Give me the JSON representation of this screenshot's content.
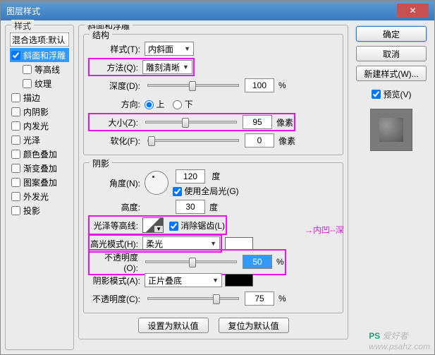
{
  "window": {
    "title": "图层样式"
  },
  "sidebar": {
    "group_label": "样式",
    "items": [
      {
        "label": "混合选项:默认",
        "checked": false,
        "header": true
      },
      {
        "label": "斜面和浮雕",
        "checked": true,
        "selected": true
      },
      {
        "label": "等高线",
        "checked": false,
        "indent": true
      },
      {
        "label": "纹理",
        "checked": false,
        "indent": true
      },
      {
        "label": "描边",
        "checked": false
      },
      {
        "label": "内阴影",
        "checked": false
      },
      {
        "label": "内发光",
        "checked": false
      },
      {
        "label": "光泽",
        "checked": false
      },
      {
        "label": "颜色叠加",
        "checked": false
      },
      {
        "label": "渐变叠加",
        "checked": false
      },
      {
        "label": "图案叠加",
        "checked": false
      },
      {
        "label": "外发光",
        "checked": false
      },
      {
        "label": "投影",
        "checked": false
      }
    ]
  },
  "main": {
    "panel_title": "斜面和浮雕",
    "structure": {
      "group_label": "结构",
      "style_label": "样式(T):",
      "style_value": "内斜面",
      "technique_label": "方法(Q):",
      "technique_value": "雕刻清晰",
      "depth_label": "深度(D):",
      "depth_value": "100",
      "depth_unit": "%",
      "direction_label": "方向:",
      "dir_up": "上",
      "dir_down": "下",
      "size_label": "大小(Z):",
      "size_value": "95",
      "size_unit": "像素",
      "soften_label": "软化(F):",
      "soften_value": "0",
      "soften_unit": "像素"
    },
    "shading": {
      "group_label": "阴影",
      "angle_label": "角度(N):",
      "angle_value": "120",
      "angle_unit": "度",
      "global_light_label": "使用全局光(G)",
      "altitude_label": "高度:",
      "altitude_value": "30",
      "altitude_unit": "度",
      "gloss_label": "光泽等高线:",
      "antialias_label": "消除锯齿(L)",
      "highlight_mode_label": "高光模式(H):",
      "highlight_mode_value": "柔光",
      "highlight_color": "#ffffff",
      "highlight_opacity_label": "不透明度(O):",
      "highlight_opacity_value": "50",
      "highlight_opacity_unit": "%",
      "shadow_mode_label": "阴影模式(A):",
      "shadow_mode_value": "正片叠底",
      "shadow_color": "#000000",
      "shadow_opacity_label": "不透明度(C):",
      "shadow_opacity_value": "75",
      "shadow_opacity_unit": "%"
    },
    "annotation": "内凹--深",
    "buttons": {
      "default": "设置为默认值",
      "reset": "复位为默认值"
    }
  },
  "right": {
    "ok": "确定",
    "cancel": "取消",
    "new_style": "新建样式(W)...",
    "preview_label": "预览(V)"
  },
  "watermark": {
    "brand": "PS",
    "text": "爱好者",
    "url": "www.psahz.com"
  }
}
